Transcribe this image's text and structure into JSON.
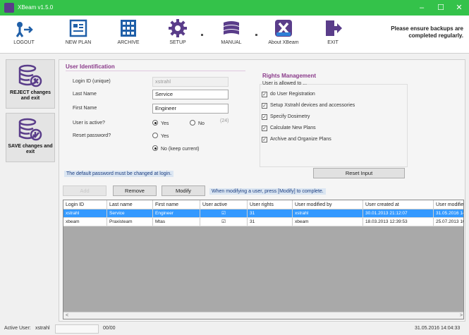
{
  "window": {
    "title": "XBeam v1.5.0",
    "brand_color": "#34c24a",
    "min": "–",
    "max": "☐",
    "close": "✕"
  },
  "toolbar": {
    "items": [
      {
        "label": "LOGOUT",
        "icon": "logout-icon"
      },
      {
        "label": "NEW PLAN",
        "icon": "new-plan-icon"
      },
      {
        "label": "ARCHIVE",
        "icon": "archive-icon"
      },
      {
        "label": "SETUP",
        "icon": "gear-icon"
      },
      {
        "label": "MANUAL",
        "icon": "manual-icon"
      },
      {
        "label": "About XBeam",
        "icon": "xbeam-logo-icon"
      },
      {
        "label": "EXIT",
        "icon": "exit-icon"
      }
    ],
    "backup_note": "Please ensure backups are completed regularly."
  },
  "sidebar": {
    "reject": {
      "label": "REJECT changes and exit",
      "icon": "database-reject-icon"
    },
    "save": {
      "label": "SAVE changes and exit",
      "icon": "database-save-icon"
    }
  },
  "identification": {
    "title": "User Identification",
    "login_label": "Login ID (unique)",
    "login_value": "xstrahl",
    "lastname_label": "Last Name",
    "lastname_value": "Service",
    "firstname_label": "First Name",
    "firstname_value": "Engineer",
    "active_label": "User is active?",
    "active_yes": "Yes",
    "active_no": "No",
    "counter": "(24)",
    "reset_label": "Reset password?",
    "reset_yes": "Yes",
    "reset_no": "No (keep current)"
  },
  "rights": {
    "title": "Rights Management",
    "subtitle": "User is allowed to ...",
    "items": [
      {
        "label": "do User Registration",
        "checked": true
      },
      {
        "label": "Setup Xstrahl devices and accessories",
        "checked": true
      },
      {
        "label": "Specify Dosimetry",
        "checked": true
      },
      {
        "label": "Calculate New Plans",
        "checked": true
      },
      {
        "label": "Archive and Organize Plans",
        "checked": true
      }
    ]
  },
  "notes": {
    "default_password": "The default password must be changed at login.",
    "modify_hint": "When modifying a user, press [Modify] to complete."
  },
  "buttons": {
    "reset_input": "Reset Input",
    "add": "Add",
    "remove": "Remove",
    "modify": "Modify"
  },
  "table": {
    "columns": [
      "Login ID",
      "Last name",
      "First name",
      "User active",
      "User rights",
      "User modified by",
      "User created at",
      "User modified"
    ],
    "rows": [
      {
        "login": "xstrahl",
        "last": "Service",
        "first": "Engineer",
        "active": "☑",
        "rights": "31",
        "modified_by": "xstrahl",
        "created": "30.01.2013 21:12:07",
        "modified": "31.05.2016 14",
        "selected": true
      },
      {
        "login": "xbeam",
        "last": "Praxisteam",
        "first": "Mtas",
        "active": "☑",
        "rights": "31",
        "modified_by": "xbeam",
        "created": "18.03.2013 12:39:53",
        "modified": "25.07.2013 10",
        "selected": false
      }
    ]
  },
  "status": {
    "active_user_label": "Active User:",
    "active_user": "xstrahl",
    "code": "00/00",
    "datetime": "31.05.2016 14:04:33"
  }
}
